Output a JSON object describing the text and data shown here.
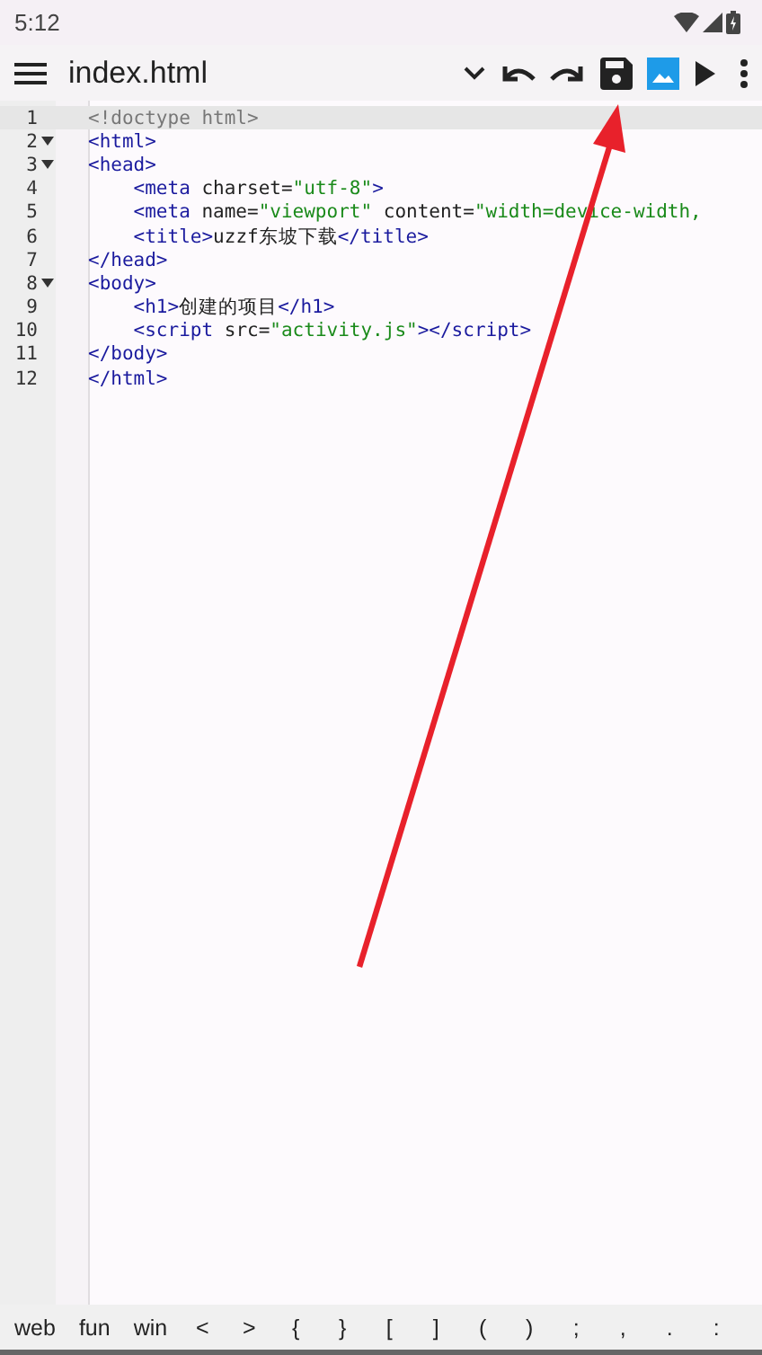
{
  "status_bar": {
    "time": "5:12"
  },
  "toolbar": {
    "title": "index.html",
    "preview_selected": true
  },
  "editor": {
    "lines": [
      {
        "number": "1",
        "fold": false,
        "current": true,
        "indented": false,
        "tokens": [
          {
            "kind": "doctype",
            "text": "<!doctype html>"
          }
        ]
      },
      {
        "number": "2",
        "fold": true,
        "current": false,
        "indented": false,
        "tokens": [
          {
            "kind": "tag",
            "text": "<html>"
          }
        ]
      },
      {
        "number": "3",
        "fold": true,
        "current": false,
        "indented": false,
        "tokens": [
          {
            "kind": "tag",
            "text": "<head>"
          }
        ]
      },
      {
        "number": "4",
        "fold": false,
        "current": false,
        "indented": true,
        "tokens": [
          {
            "kind": "tag",
            "text": "<meta"
          },
          {
            "kind": "plain",
            "text": " charset="
          },
          {
            "kind": "string",
            "text": "\"utf-8\""
          },
          {
            "kind": "tag",
            "text": ">"
          }
        ]
      },
      {
        "number": "5",
        "fold": false,
        "current": false,
        "indented": true,
        "tokens": [
          {
            "kind": "tag",
            "text": "<meta"
          },
          {
            "kind": "plain",
            "text": " name="
          },
          {
            "kind": "string",
            "text": "\"viewport\""
          },
          {
            "kind": "plain",
            "text": " content="
          },
          {
            "kind": "string",
            "text": "\"width=device-width,"
          }
        ]
      },
      {
        "number": "6",
        "fold": false,
        "current": false,
        "indented": true,
        "tokens": [
          {
            "kind": "tag",
            "text": "<title>"
          },
          {
            "kind": "plain",
            "text": "uzzf东坡下载"
          },
          {
            "kind": "tag",
            "text": "</title>"
          }
        ]
      },
      {
        "number": "7",
        "fold": false,
        "current": false,
        "indented": false,
        "tokens": [
          {
            "kind": "tag",
            "text": "</head>"
          }
        ]
      },
      {
        "number": "8",
        "fold": true,
        "current": false,
        "indented": false,
        "tokens": [
          {
            "kind": "tag",
            "text": "<body>"
          }
        ]
      },
      {
        "number": "9",
        "fold": false,
        "current": false,
        "indented": true,
        "tokens": [
          {
            "kind": "tag",
            "text": "<h1>"
          },
          {
            "kind": "plain",
            "text": "创建的项目"
          },
          {
            "kind": "tag",
            "text": "</h1>"
          }
        ]
      },
      {
        "number": "10",
        "fold": false,
        "current": false,
        "indented": true,
        "tokens": [
          {
            "kind": "tag",
            "text": "<script"
          },
          {
            "kind": "plain",
            "text": " src="
          },
          {
            "kind": "string",
            "text": "\"activity.js\""
          },
          {
            "kind": "tag",
            "text": "></script>"
          }
        ]
      },
      {
        "number": "11",
        "fold": false,
        "current": false,
        "indented": false,
        "tokens": [
          {
            "kind": "tag",
            "text": "</body>"
          }
        ]
      },
      {
        "number": "12",
        "fold": false,
        "current": false,
        "indented": false,
        "tokens": [
          {
            "kind": "tag",
            "text": "</html>"
          }
        ]
      }
    ]
  },
  "symbol_bar": [
    "web",
    "fun",
    "win",
    "<",
    ">",
    "{",
    "}",
    "[",
    "]",
    "(",
    ")",
    ";",
    ",",
    ".",
    ":"
  ]
}
